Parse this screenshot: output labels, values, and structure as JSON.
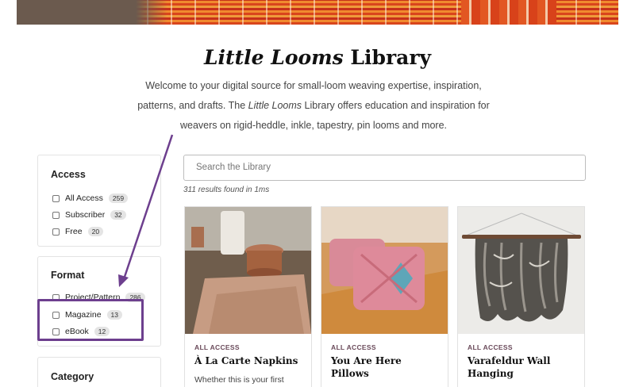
{
  "header": {
    "title_italic": "Little Looms",
    "title_rest": " Library",
    "intro_part1": "Welcome to your digital source for small-loom weaving expertise, inspiration, patterns, and drafts. The ",
    "intro_em": "Little Looms",
    "intro_part2": " Library offers education and inspiration for weavers on rigid-heddle, inkle, tapestry, pin looms and more."
  },
  "filters": {
    "access": {
      "title": "Access",
      "options": [
        {
          "label": "All Access",
          "count": "259"
        },
        {
          "label": "Subscriber",
          "count": "32"
        },
        {
          "label": "Free",
          "count": "20"
        }
      ]
    },
    "format": {
      "title": "Format",
      "options": [
        {
          "label": "Project/Pattern",
          "count": "286"
        },
        {
          "label": "Magazine",
          "count": "13"
        },
        {
          "label": "eBook",
          "count": "12"
        }
      ]
    },
    "category": {
      "title": "Category"
    }
  },
  "search": {
    "placeholder": "Search the Library",
    "results_text": "311 results found in 1ms"
  },
  "cards": [
    {
      "tag": "ALL ACCESS",
      "title": "À La Carte Napkins",
      "desc": "Whether this is your first"
    },
    {
      "tag": "ALL ACCESS",
      "title": "You Are Here Pillows",
      "desc": ""
    },
    {
      "tag": "ALL ACCESS",
      "title": "Varafeldur Wall Hanging",
      "desc": ""
    }
  ],
  "colors": {
    "annotation": "#6d3f8e",
    "tag": "#6a4a5a"
  }
}
